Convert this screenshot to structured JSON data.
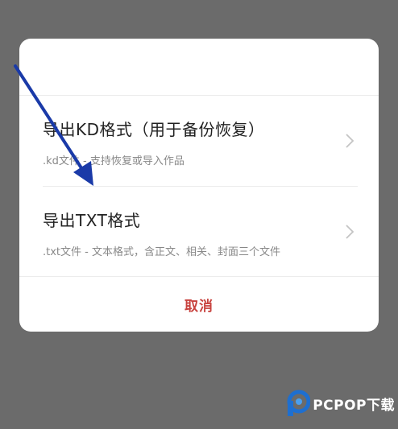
{
  "dialog": {
    "options": [
      {
        "title": "导出KD格式（用于备份恢复）",
        "description": ".kd文件 - 支持恢复或导入作品"
      },
      {
        "title": "导出TXT格式",
        "description": ".txt文件 - 文本格式，含正文、相关、封面三个文件"
      }
    ],
    "cancel_label": "取消"
  },
  "watermark": {
    "text": "PCPOP下载"
  },
  "colors": {
    "overlay": "#6b6b6b",
    "cancel": "#c8433f",
    "annotation_arrow": "#1a3aa8",
    "watermark_accent": "#1e6fd0"
  }
}
